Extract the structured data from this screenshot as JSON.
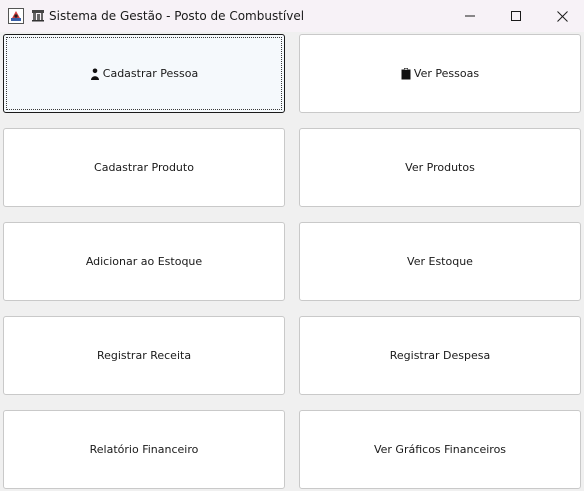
{
  "window": {
    "title": "Sistema de Gestão - Posto de Combustível",
    "title_icon": "fuel-station-icon"
  },
  "buttons": [
    {
      "label": "Cadastrar Pessoa",
      "icon": "person-icon"
    },
    {
      "label": "Ver Pessoas",
      "icon": "clipboard-icon"
    },
    {
      "label": "Cadastrar Produto"
    },
    {
      "label": "Ver Produtos"
    },
    {
      "label": "Adicionar ao Estoque"
    },
    {
      "label": "Ver Estoque"
    },
    {
      "label": "Registrar Receita"
    },
    {
      "label": "Registrar Despesa"
    },
    {
      "label": "Relatório Financeiro"
    },
    {
      "label": "Ver Gráficos Financeiros"
    }
  ]
}
